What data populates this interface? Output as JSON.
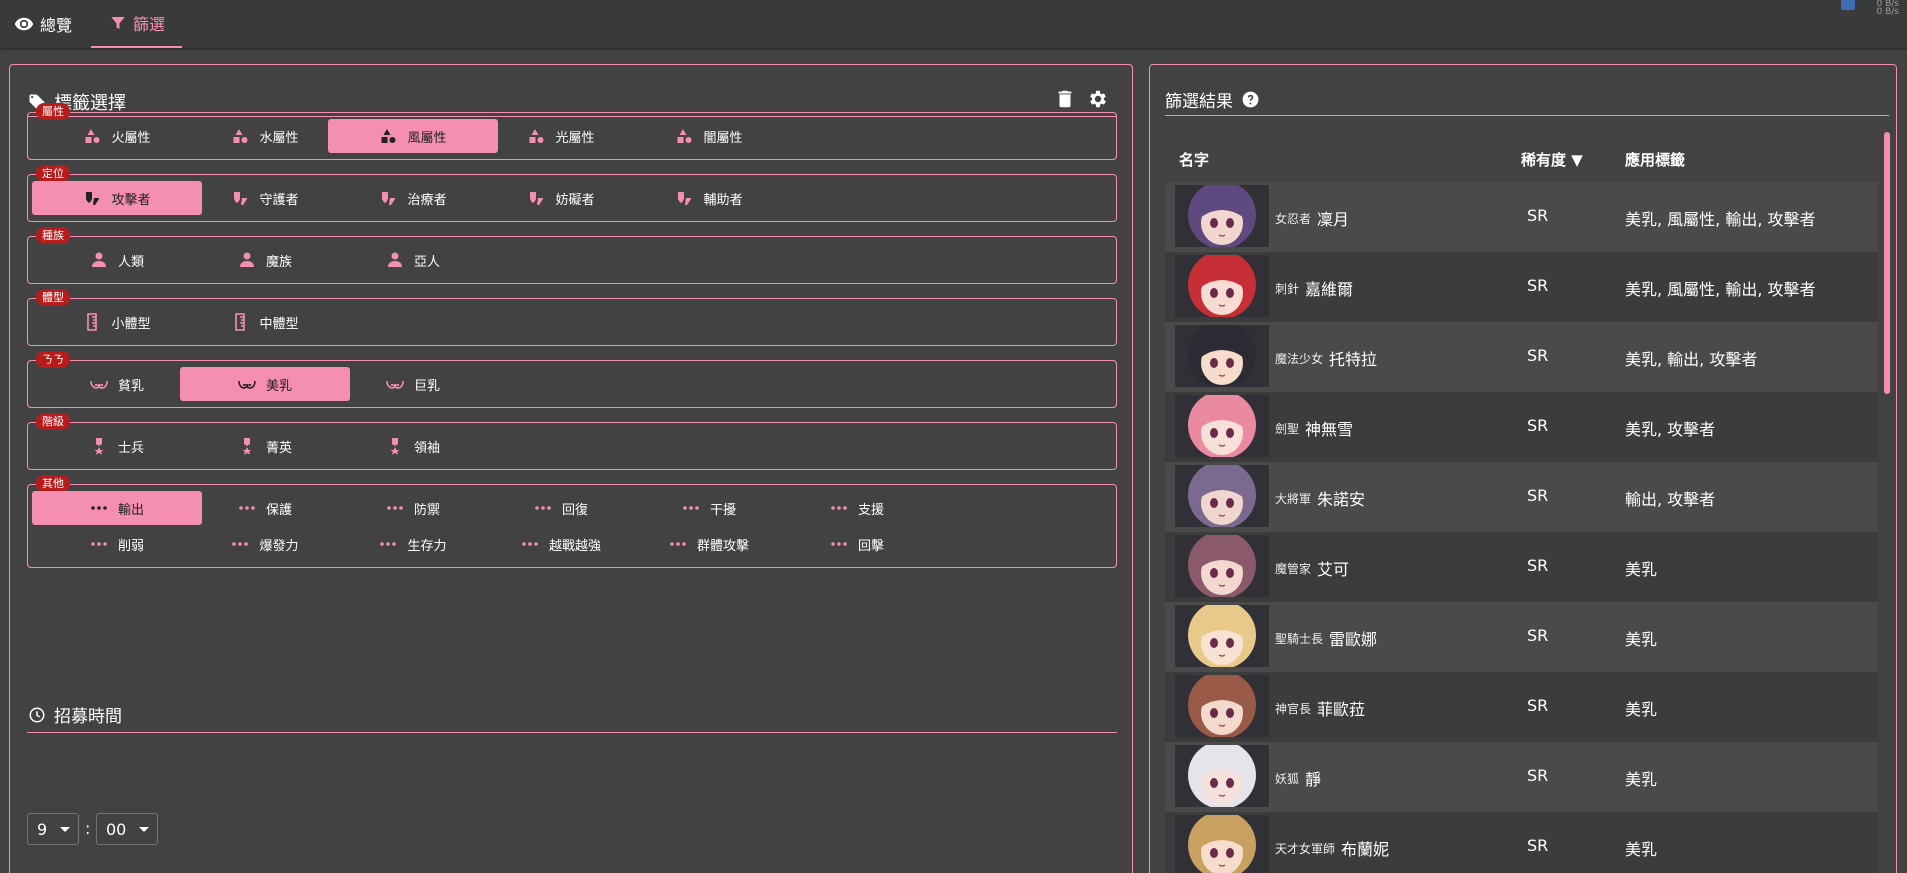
{
  "tabs": [
    {
      "label": "總覽",
      "icon": "eye-icon"
    },
    {
      "label": "篩選",
      "icon": "filter-icon"
    }
  ],
  "corner": {
    "line1": "0 B/s",
    "line2": "0 B/s"
  },
  "tag_select": {
    "title": "標籤選擇",
    "groups": [
      {
        "label": "屬性",
        "options": [
          {
            "text": "火屬性",
            "selected": false
          },
          {
            "text": "水屬性",
            "selected": false
          },
          {
            "text": "風屬性",
            "selected": true
          },
          {
            "text": "光屬性",
            "selected": false
          },
          {
            "text": "闇屬性",
            "selected": false
          }
        ]
      },
      {
        "label": "定位",
        "options": [
          {
            "text": "攻擊者",
            "selected": true
          },
          {
            "text": "守護者",
            "selected": false
          },
          {
            "text": "治療者",
            "selected": false
          },
          {
            "text": "妨礙者",
            "selected": false
          },
          {
            "text": "輔助者",
            "selected": false
          }
        ]
      },
      {
        "label": "種族",
        "options": [
          {
            "text": "人類",
            "selected": false
          },
          {
            "text": "魔族",
            "selected": false
          },
          {
            "text": "亞人",
            "selected": false
          }
        ]
      },
      {
        "label": "體型",
        "options": [
          {
            "text": "小體型",
            "selected": false
          },
          {
            "text": "中體型",
            "selected": false
          }
        ]
      },
      {
        "label": "ㄋㄋ",
        "options": [
          {
            "text": "貧乳",
            "selected": false
          },
          {
            "text": "美乳",
            "selected": true
          },
          {
            "text": "巨乳",
            "selected": false
          }
        ]
      },
      {
        "label": "階級",
        "options": [
          {
            "text": "士兵",
            "selected": false
          },
          {
            "text": "菁英",
            "selected": false
          },
          {
            "text": "領袖",
            "selected": false
          }
        ]
      },
      {
        "label": "其他",
        "options": [
          {
            "text": "輸出",
            "selected": true
          },
          {
            "text": "保護",
            "selected": false
          },
          {
            "text": "防禦",
            "selected": false
          },
          {
            "text": "回復",
            "selected": false
          },
          {
            "text": "干擾",
            "selected": false
          },
          {
            "text": "支援",
            "selected": false
          },
          {
            "text": "削弱",
            "selected": false
          },
          {
            "text": "爆發力",
            "selected": false
          },
          {
            "text": "生存力",
            "selected": false
          },
          {
            "text": "越戰越強",
            "selected": false
          },
          {
            "text": "群體攻擊",
            "selected": false
          },
          {
            "text": "回擊",
            "selected": false
          }
        ]
      }
    ]
  },
  "recruit": {
    "title": "招募時間",
    "hour": "9",
    "separator": ":",
    "minute": "00"
  },
  "results": {
    "title": "篩選結果",
    "columns": {
      "name": "名字",
      "rarity": "稀有度 ▼",
      "tags": "應用標籤"
    },
    "rows": [
      {
        "title": "女忍者",
        "name": "凜月",
        "rarity": "SR",
        "tags": "美乳, 風屬性, 輸出, 攻擊者",
        "hair": "#5e4a7e",
        "skin": "#f3d6cf"
      },
      {
        "title": "刺針",
        "name": "嘉維爾",
        "rarity": "SR",
        "tags": "美乳, 風屬性, 輸出, 攻擊者",
        "hair": "#c62f35",
        "skin": "#f6dcd2"
      },
      {
        "title": "魔法少女",
        "name": "托特拉",
        "rarity": "SR",
        "tags": "美乳, 輸出, 攻擊者",
        "hair": "#2b2b33",
        "skin": "#f5dccb"
      },
      {
        "title": "劍聖",
        "name": "神無雪",
        "rarity": "SR",
        "tags": "美乳, 攻擊者",
        "hair": "#e98aa0",
        "skin": "#f7e0d8"
      },
      {
        "title": "大將軍",
        "name": "朱諾安",
        "rarity": "SR",
        "tags": "輸出, 攻擊者",
        "hair": "#7a6a8f",
        "skin": "#efd7cf"
      },
      {
        "title": "魔管家",
        "name": "艾可",
        "rarity": "SR",
        "tags": "美乳",
        "hair": "#8a5a6a",
        "skin": "#f3d8d0"
      },
      {
        "title": "聖騎士長",
        "name": "雷歐娜",
        "rarity": "SR",
        "tags": "美乳",
        "hair": "#e8c98a",
        "skin": "#f8e2d2"
      },
      {
        "title": "神官長",
        "name": "菲歐菈",
        "rarity": "SR",
        "tags": "美乳",
        "hair": "#9a5a48",
        "skin": "#f4dacb"
      },
      {
        "title": "妖狐",
        "name": "靜",
        "rarity": "SR",
        "tags": "美乳",
        "hair": "#e4e4ea",
        "skin": "#f6e2dc"
      },
      {
        "title": "天才女軍師",
        "name": "布蘭妮",
        "rarity": "SR",
        "tags": "美乳",
        "hair": "#c8a060",
        "skin": "#f5dccd"
      }
    ]
  }
}
